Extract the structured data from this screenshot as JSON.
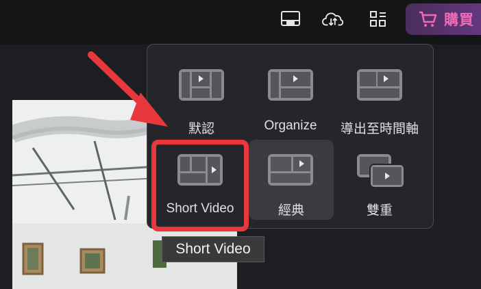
{
  "header": {
    "buy_label": "購買",
    "icons": [
      "layout-icon",
      "cloud-sync-icon",
      "grid-apps-icon",
      "cart-icon"
    ]
  },
  "layout_menu": {
    "options": [
      {
        "label": "默認",
        "icon": "default-layout-icon"
      },
      {
        "label": "Organize",
        "icon": "organize-layout-icon"
      },
      {
        "label": "導出至時間軸",
        "icon": "export-timeline-layout-icon"
      },
      {
        "label": "Short Video",
        "icon": "short-video-layout-icon"
      },
      {
        "label": "經典",
        "icon": "classic-layout-icon",
        "selected": true
      },
      {
        "label": "雙重",
        "icon": "dual-layout-icon"
      }
    ]
  },
  "tooltip": {
    "text": "Short Video"
  },
  "colors": {
    "accent_pink": "#f06ab4",
    "highlight_red": "#e8383d",
    "panel_bg": "#25262a",
    "selected_bg": "#3a3b40"
  }
}
